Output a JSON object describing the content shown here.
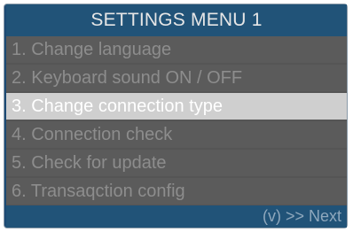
{
  "title": "SETTINGS MENU 1",
  "menu": {
    "items": [
      {
        "label": "1. Change language",
        "selected": false
      },
      {
        "label": "2. Keyboard sound ON / OFF",
        "selected": false
      },
      {
        "label": "3. Change connection type",
        "selected": true
      },
      {
        "label": "4. Connection check",
        "selected": false
      },
      {
        "label": "5. Check for update",
        "selected": false
      },
      {
        "label": "6. Transaqction config",
        "selected": false
      }
    ]
  },
  "footer": {
    "next_hint": "(v) >> Next"
  },
  "colors": {
    "header_bg": "#215378",
    "item_bg": "#5b5b5b",
    "item_text": "#8d8d8d",
    "selected_bg": "#cfcfcf",
    "selected_text": "#ffffff"
  }
}
